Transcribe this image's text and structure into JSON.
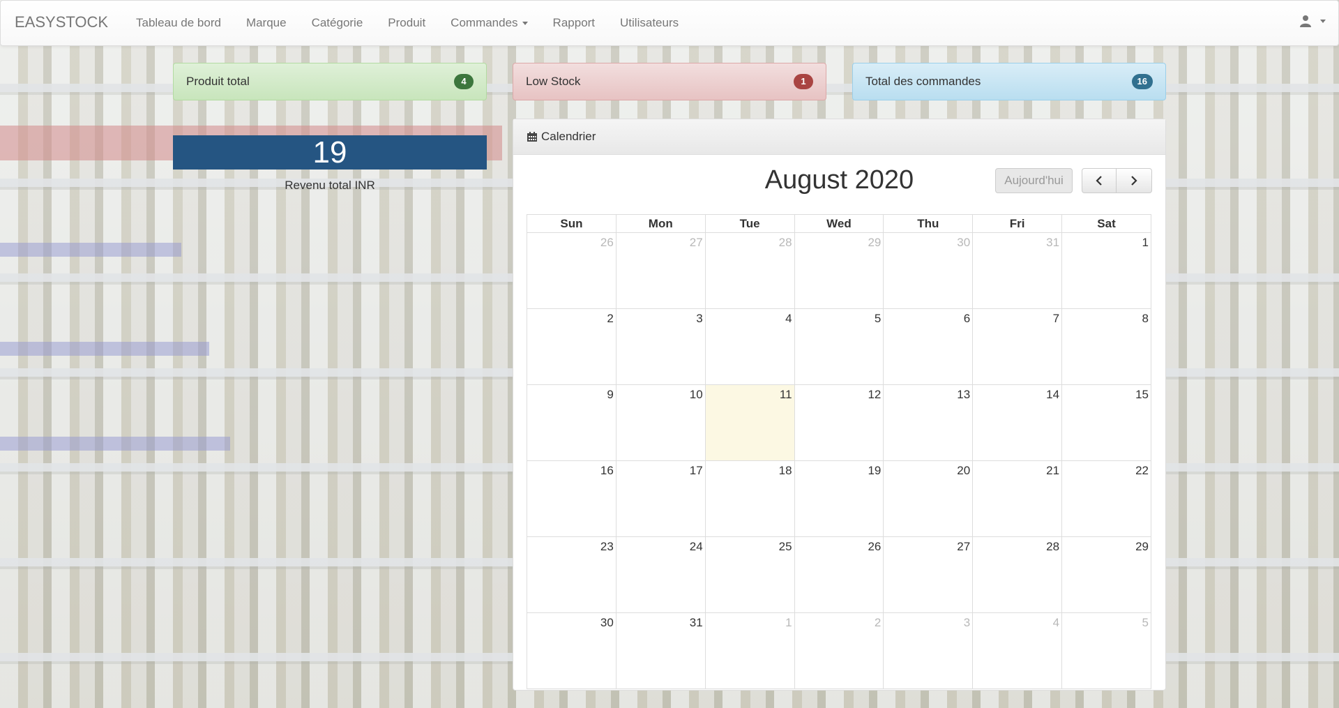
{
  "navbar": {
    "brand": "EASYSTOCK",
    "links": [
      "Tableau de bord",
      "Marque",
      "Catégorie",
      "Produit",
      "Commandes",
      "Rapport",
      "Utilisateurs"
    ],
    "user_icon": "user-icon"
  },
  "stats": {
    "products": {
      "label": "Produit total",
      "count": "4",
      "color": "#3c763d"
    },
    "low_stock": {
      "label": "Low Stock",
      "count": "1",
      "color": "#a94442"
    },
    "orders": {
      "label": "Total des commandes",
      "count": "16",
      "color": "#31708f"
    }
  },
  "revenue": {
    "value": "19",
    "caption": "Revenu total INR"
  },
  "calendar": {
    "heading": "Calendrier",
    "title": "August 2020",
    "today_button": "Aujourd'hui",
    "weekdays": [
      "Sun",
      "Mon",
      "Tue",
      "Wed",
      "Thu",
      "Fri",
      "Sat"
    ],
    "weeks": [
      [
        "26",
        "27",
        "28",
        "29",
        "30",
        "31",
        "1"
      ],
      [
        "2",
        "3",
        "4",
        "5",
        "6",
        "7",
        "8"
      ],
      [
        "9",
        "10",
        "11",
        "12",
        "13",
        "14",
        "15"
      ],
      [
        "16",
        "17",
        "18",
        "19",
        "20",
        "21",
        "22"
      ],
      [
        "23",
        "24",
        "25",
        "26",
        "27",
        "28",
        "29"
      ],
      [
        "30",
        "31",
        "1",
        "2",
        "3",
        "4",
        "5"
      ]
    ],
    "today": "11"
  }
}
